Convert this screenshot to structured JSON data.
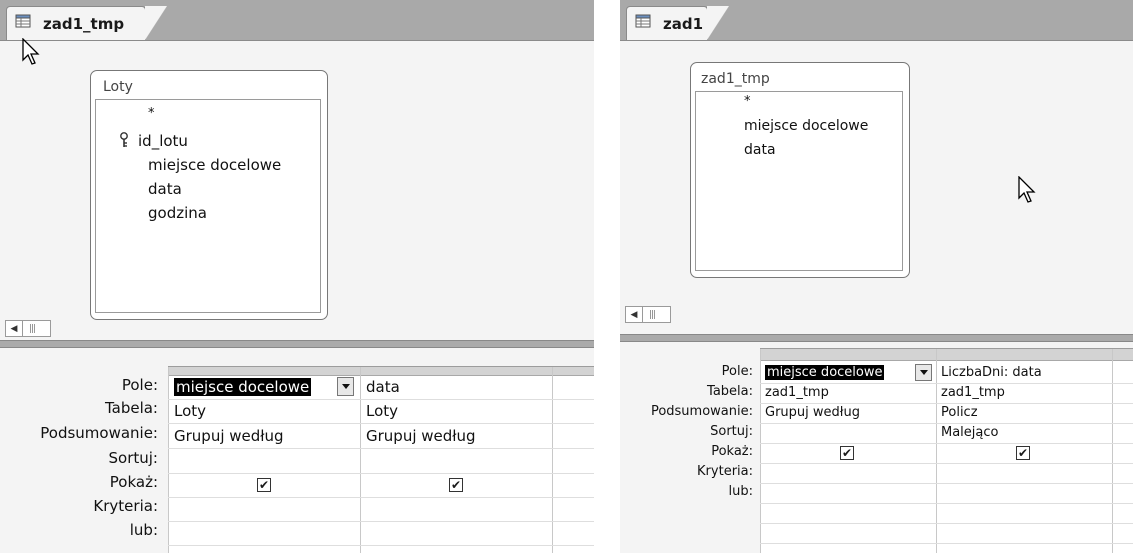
{
  "left": {
    "tab_title": "zad1_tmp",
    "table_box": {
      "title": "Loty",
      "fields": [
        "*",
        "id_lotu",
        "miejsce docelowe",
        "data",
        "godzina"
      ],
      "key_field": "id_lotu"
    },
    "grid": {
      "row_labels": [
        "Pole:",
        "Tabela:",
        "Podsumowanie:",
        "Sortuj:",
        "Pokaż:",
        "Kryteria:",
        "lub:"
      ],
      "columns": [
        {
          "pole": "miejsce docelowe",
          "tabela": "Loty",
          "podsumowanie": "Grupuj według",
          "sortuj": "",
          "pokaz": true
        },
        {
          "pole": "data",
          "tabela": "Loty",
          "podsumowanie": "Grupuj według",
          "sortuj": "",
          "pokaz": true
        }
      ]
    }
  },
  "right": {
    "tab_title": "zad1",
    "table_box": {
      "title": "zad1_tmp",
      "fields": [
        "*",
        "miejsce docelowe",
        "data"
      ]
    },
    "grid": {
      "row_labels": [
        "Pole:",
        "Tabela:",
        "Podsumowanie:",
        "Sortuj:",
        "Pokaż:",
        "Kryteria:",
        "lub:"
      ],
      "columns": [
        {
          "pole": "miejsce docelowe",
          "tabela": "zad1_tmp",
          "podsumowanie": "Grupuj według",
          "sortuj": "",
          "pokaz": true
        },
        {
          "pole": "LiczbaDni: data",
          "tabela": "zad1_tmp",
          "podsumowanie": "Policz",
          "sortuj": "Malejąco",
          "pokaz": true
        }
      ]
    }
  },
  "icons": {
    "tab": "query-icon",
    "key": "primary-key-icon",
    "dropdown": "dropdown-arrow-icon",
    "checkbox_checked": "checkbox-checked-icon",
    "scroll_left": "scroll-left-arrow-icon",
    "pointer": "mouse-pointer-icon"
  },
  "glyphs": {
    "check": "✔",
    "arrow_left": "◀",
    "thumb": "|||"
  }
}
